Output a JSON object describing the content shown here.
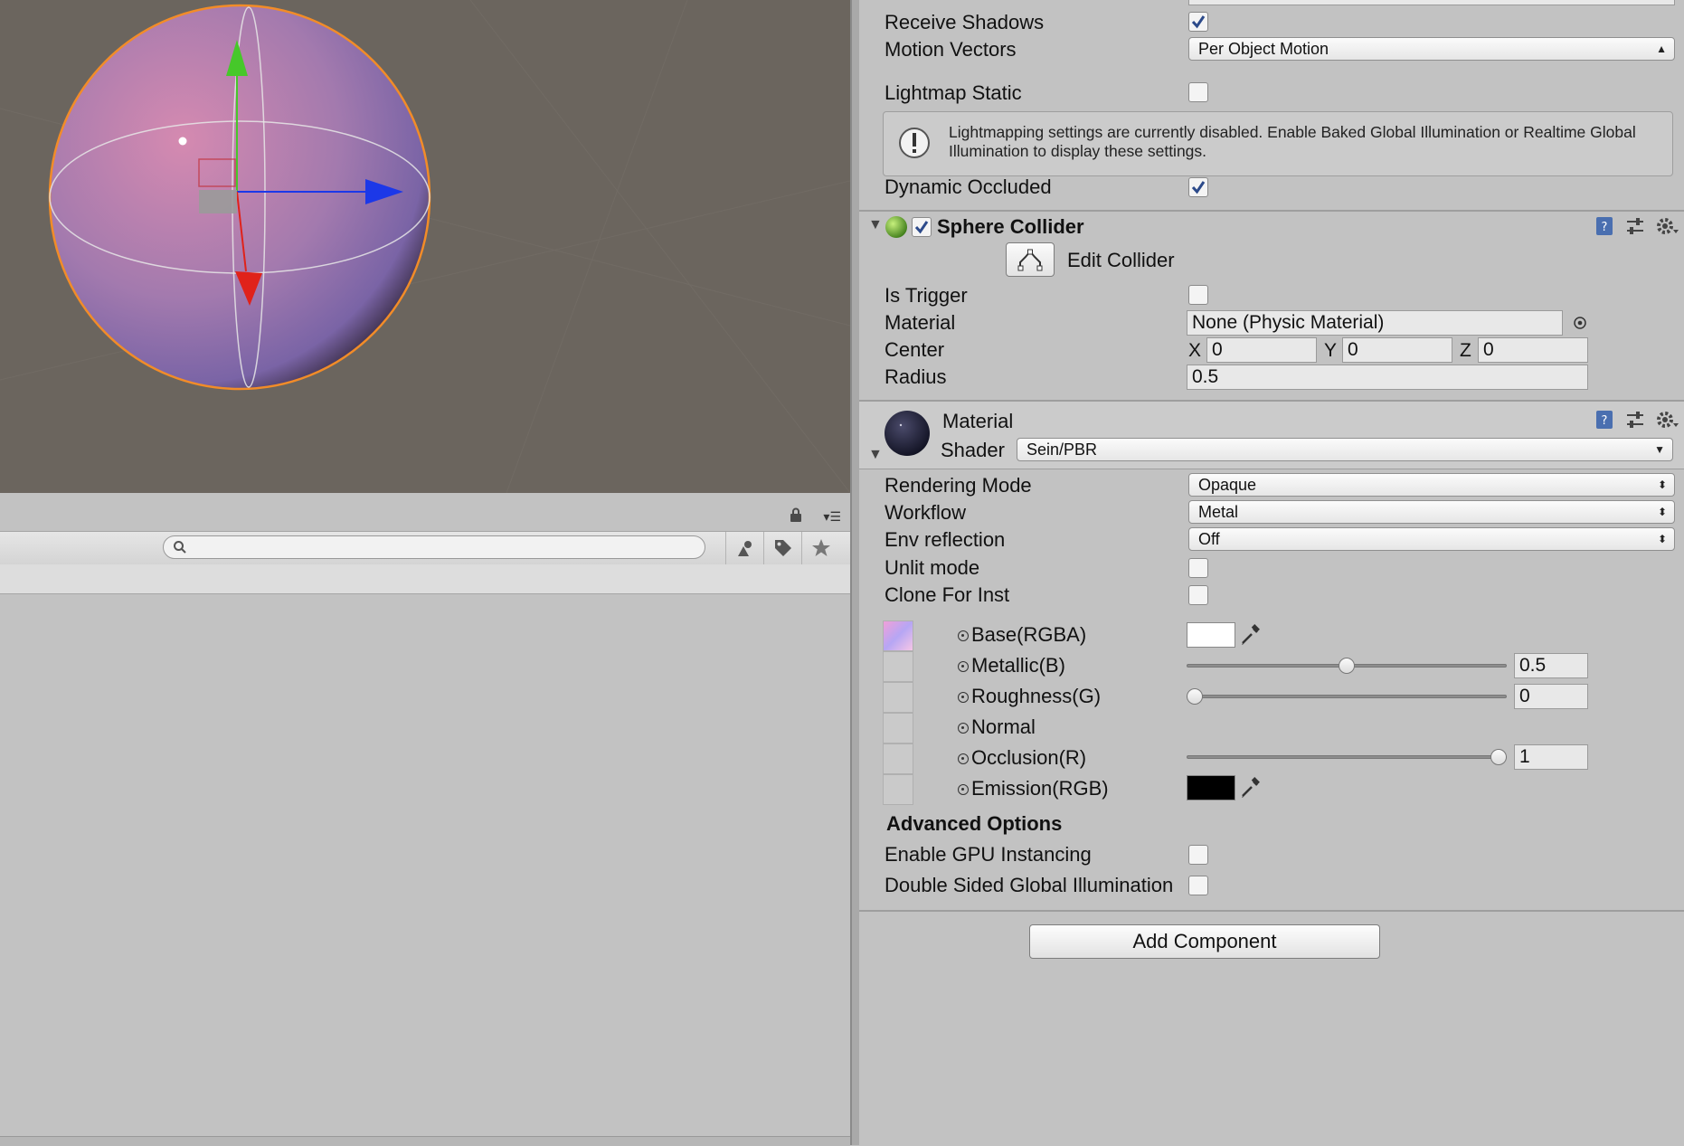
{
  "scene": {
    "sphere_color": "#b07aa8",
    "outline_color": "#f28c28",
    "gizmo_colors": {
      "x": "#1c38e8",
      "y": "#46c82a",
      "z": "#e0221a"
    }
  },
  "browser": {
    "search_placeholder": ""
  },
  "mesh_renderer": {
    "receive_shadows": {
      "label": "Receive Shadows",
      "checked": true
    },
    "motion_vectors": {
      "label": "Motion Vectors",
      "value": "Per Object Motion"
    },
    "lightmap_static": {
      "label": "Lightmap Static",
      "checked": false
    },
    "help": "Lightmapping settings are currently disabled. Enable Baked Global Illumination or Realtime Global Illumination to display these settings.",
    "dynamic_occluded": {
      "label": "Dynamic Occluded",
      "checked": true
    }
  },
  "sphere_collider": {
    "title": "Sphere Collider",
    "enabled": true,
    "edit_collider": "Edit Collider",
    "is_trigger": {
      "label": "Is Trigger",
      "checked": false
    },
    "material": {
      "label": "Material",
      "value": "None (Physic Material)"
    },
    "center": {
      "label": "Center",
      "x_label": "X",
      "x": "0",
      "y_label": "Y",
      "y": "0",
      "z_label": "Z",
      "z": "0"
    },
    "radius": {
      "label": "Radius",
      "value": "0.5"
    }
  },
  "material": {
    "title": "Material",
    "shader_label": "Shader",
    "shader_value": "Sein/PBR",
    "rendering_mode": {
      "label": "Rendering Mode",
      "value": "Opaque"
    },
    "workflow": {
      "label": "Workflow",
      "value": "Metal"
    },
    "env_reflection": {
      "label": "Env reflection",
      "value": "Off"
    },
    "unlit_mode": {
      "label": "Unlit mode",
      "checked": false
    },
    "clone_for_inst": {
      "label": "Clone For Inst",
      "checked": false
    },
    "base": {
      "label": "Base(RGBA)",
      "color": "#ffffff"
    },
    "metallic": {
      "label": "Metallic(B)",
      "value": "0.5",
      "fraction": 0.5
    },
    "roughness": {
      "label": "Roughness(G)",
      "value": "0",
      "fraction": 0
    },
    "normal": {
      "label": "Normal"
    },
    "occlusion": {
      "label": "Occlusion(R)",
      "value": "1",
      "fraction": 1
    },
    "emission": {
      "label": "Emission(RGB)",
      "color": "#000000"
    },
    "advanced_title": "Advanced Options",
    "gpu_instancing": {
      "label": "Enable GPU Instancing",
      "checked": false
    },
    "double_sided_gi": {
      "label": "Double Sided Global Illumination",
      "checked": false
    }
  },
  "add_component": "Add Component"
}
